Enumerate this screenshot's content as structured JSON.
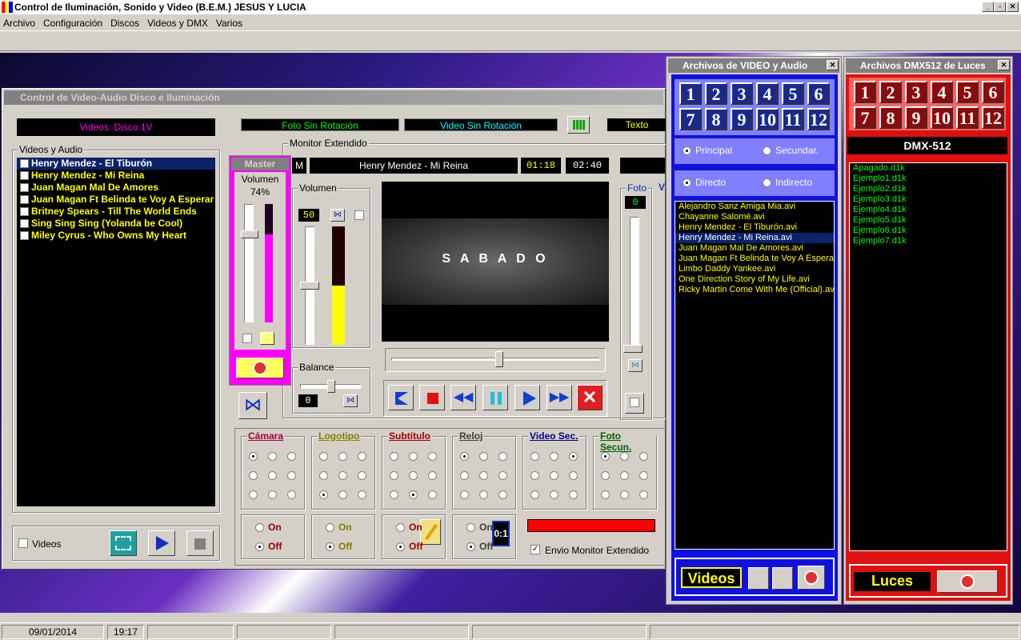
{
  "window": {
    "title": "Control de Iluminación, Sonido y Video (B.E.M.)  JESUS Y LUCIA"
  },
  "menu": [
    "Archivo",
    "Configuración",
    "Discos",
    "Videos y DMX",
    "Varios"
  ],
  "status": {
    "date": "09/01/2014",
    "time": "19:17"
  },
  "main": {
    "title": "Control de  Video-Audio Disco e Iluminación",
    "disc_label": "Videos: Disco 1V",
    "list_title": "Videos y Audio",
    "tracks": [
      "Henry Mendez - El Tiburón",
      "Henry Mendez - Mi Reina",
      "Juan Magan   Mal De Amores",
      "Juan Magan Ft Belinda te Voy A Esperar",
      "Britney Spears - Till The World Ends",
      "Sing Sing Sing (Yolanda be Cool)",
      "Miley Cyrus - Who Owns My Heart"
    ],
    "videos_check": "Videos",
    "foto_rot": "Foto Sin Rotación",
    "video_rot": "Video Sin Rotación",
    "texto": "Texto",
    "monitor_title": "Monitor Extendido",
    "monitor_m": "M",
    "now_playing": "Henry Mendez - Mi Reina",
    "elapsed": "01:18",
    "total": "02:40",
    "master": {
      "title": "Master",
      "vol_label": "Volumen",
      "vol_pct": "74%",
      "level": 0.74
    },
    "volume": {
      "label": "Volumen",
      "value": "50",
      "level": 0.5
    },
    "balance": {
      "label": "Balance",
      "value": "0"
    },
    "video_text": "S A B A D O",
    "seek": 0.52,
    "foto_label": "Foto",
    "foto_value": "0",
    "v_label": "V",
    "groups": [
      {
        "label": "Cámara",
        "color": "#a0003c",
        "sel": [
          0,
          0
        ]
      },
      {
        "label": "Logotipo",
        "color": "#808000",
        "sel": [
          2,
          0
        ]
      },
      {
        "label": "Subtítulo",
        "color": "#a00000",
        "sel": [
          2,
          1
        ]
      },
      {
        "label": "Reloj",
        "color": "#404040",
        "sel": [
          0,
          0
        ]
      },
      {
        "label": "Video Sec.",
        "color": "#00008c",
        "sel": [
          0,
          2
        ]
      },
      {
        "label": "Foto Secun.",
        "color": "#006000",
        "sel": [
          0,
          0
        ]
      }
    ],
    "onoff": [
      {
        "on": "On",
        "off": "Off",
        "on_color": "#a00000",
        "off_color": "#a00000"
      },
      {
        "on": "On",
        "off": "Off",
        "on_color": "#808000",
        "off_color": "#808000"
      },
      {
        "on": "On",
        "off": "Off",
        "on_color": "#a00000",
        "off_color": "#a00000"
      },
      {
        "on": "On",
        "off": "Off",
        "on_color": "#404040",
        "off_color": "#404040"
      }
    ],
    "clock_text": "0:1",
    "envio": "Envio Monitor Extendido"
  },
  "video_panel": {
    "title": "Archivos de VIDEO y Audio",
    "numbers": [
      "1",
      "2",
      "3",
      "4",
      "5",
      "6",
      "7",
      "8",
      "9",
      "10",
      "11",
      "12"
    ],
    "principal": "Principal",
    "secundar": "Secundar.",
    "directo": "Directo",
    "indirecto": "Indirecto",
    "files": [
      "Alejandro Sanz  Amiga Mia.avi",
      "Chayanne   Salomé.avi",
      "Henry Mendez - El Tiburón.avi",
      "Henry Mendez - Mi Reina.avi",
      "Juan Magan   Mal De Amores.avi",
      "Juan Magan Ft Belinda te Voy A Esperar.avi",
      "Limbo Daddy Yankee.avi",
      "One Direction   Story of My Life.avi",
      "Ricky Martin   Come With Me (Official).avi"
    ],
    "videos_label": "Videos"
  },
  "dmx_panel": {
    "title": "Archivos DMX512 de Luces",
    "numbers": [
      "1",
      "2",
      "3",
      "4",
      "5",
      "6",
      "7",
      "8",
      "9",
      "10",
      "11",
      "12"
    ],
    "dmx_label": "DMX-512",
    "files": [
      "Apagado.d1k",
      "Ejemplo1.d1k",
      "Ejemplo2.d1k",
      "Ejemplo3.d1k",
      "Ejemplo4.d1k",
      "Ejemplo5.d1k",
      "Ejemplo6.d1k",
      "Ejemplo7.d1k"
    ],
    "luces_label": "Luces"
  },
  "colors": {
    "magenta": "#ff00ff",
    "blue_panel": "#1010e0",
    "red_panel": "#e01010",
    "yellow": "#ffff00",
    "led_green": "#00ff00"
  }
}
